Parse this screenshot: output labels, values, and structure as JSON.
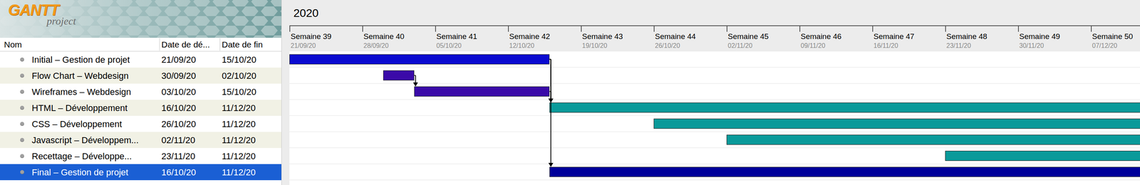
{
  "logo": {
    "title": "GANTT",
    "subtitle": "project"
  },
  "table": {
    "columns": [
      "Nom",
      "Date de dé...",
      "Date de fin"
    ]
  },
  "chart": {
    "year": "2020",
    "weeks": [
      {
        "label": "Semaine 39",
        "date": "21/09/20"
      },
      {
        "label": "Semaine 40",
        "date": "28/09/20"
      },
      {
        "label": "Semaine 41",
        "date": "05/10/20"
      },
      {
        "label": "Semaine 42",
        "date": "12/10/20"
      },
      {
        "label": "Semaine 43",
        "date": "19/10/20"
      },
      {
        "label": "Semaine 44",
        "date": "26/10/20"
      },
      {
        "label": "Semaine 45",
        "date": "02/11/20"
      },
      {
        "label": "Semaine 46",
        "date": "09/11/20"
      },
      {
        "label": "Semaine 47",
        "date": "16/11/20"
      },
      {
        "label": "Semaine 48",
        "date": "23/11/20"
      },
      {
        "label": "Semaine 49",
        "date": "30/11/20"
      },
      {
        "label": "Semaine 50",
        "date": "07/12/20"
      }
    ]
  },
  "tasks": [
    {
      "name": "Initial – Gestion de projet",
      "start": "21/09/20",
      "end": "15/10/20",
      "color": "#0a0ad0",
      "selected": false,
      "predecessors": []
    },
    {
      "name": "Flow Chart – Webdesign",
      "start": "30/09/20",
      "end": "02/10/20",
      "color": "#3a0aa8",
      "selected": false,
      "predecessors": []
    },
    {
      "name": "Wireframes – Webdesign",
      "start": "03/10/20",
      "end": "15/10/20",
      "color": "#3a0aa8",
      "selected": false,
      "predecessors": [
        1
      ]
    },
    {
      "name": "HTML – Développement",
      "start": "16/10/20",
      "end": "11/12/20",
      "color": "#0a9a9a",
      "selected": false,
      "predecessors": [
        0,
        2
      ]
    },
    {
      "name": "CSS – Développement",
      "start": "26/10/20",
      "end": "11/12/20",
      "color": "#0a9a9a",
      "selected": false,
      "predecessors": []
    },
    {
      "name": "Javascript – Développem...",
      "start": "02/11/20",
      "end": "11/12/20",
      "color": "#0a9a9a",
      "selected": false,
      "predecessors": []
    },
    {
      "name": "Recettage – Développe...",
      "start": "23/11/20",
      "end": "11/12/20",
      "color": "#0a9a9a",
      "selected": false,
      "predecessors": []
    },
    {
      "name": "Final – Gestion de projet",
      "start": "16/10/20",
      "end": "11/12/20",
      "color": "#00009a",
      "selected": true,
      "predecessors": [
        0
      ]
    }
  ]
}
